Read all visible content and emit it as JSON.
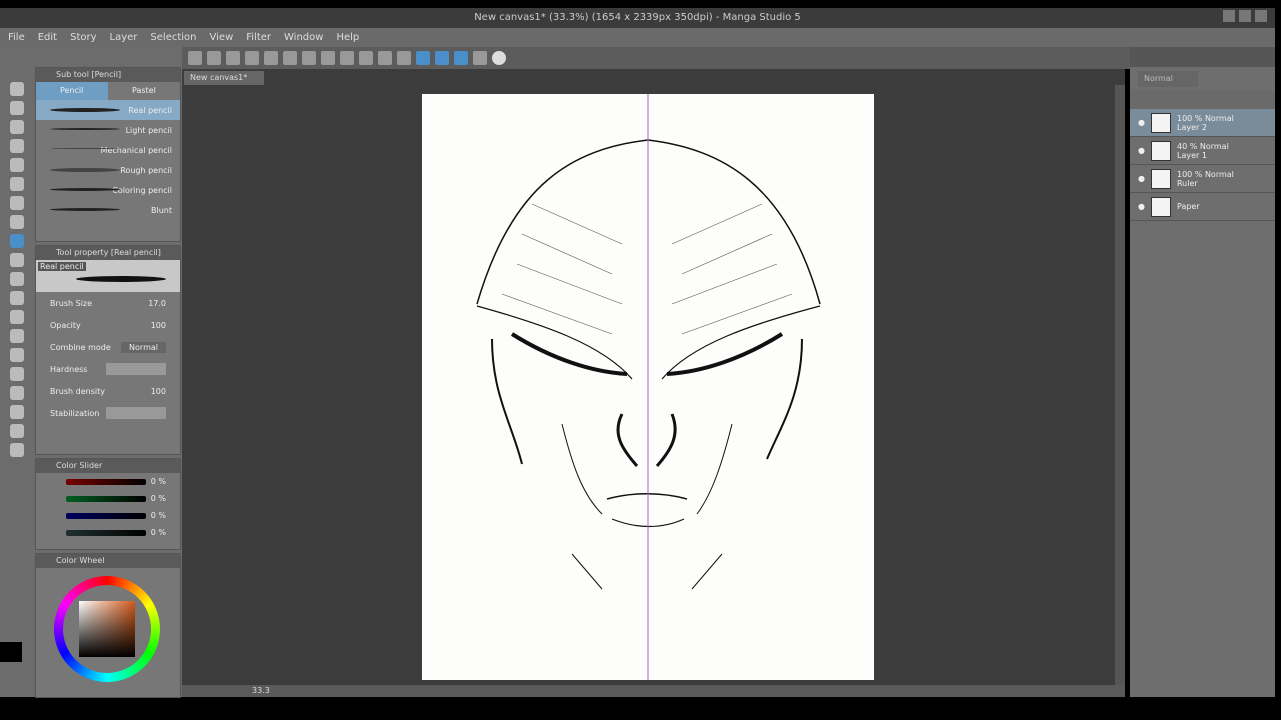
{
  "window": {
    "title": "New canvas1* (33.3%) (1654 x 2339px 350dpi) - Manga Studio 5"
  },
  "menu": [
    "File",
    "Edit",
    "Story",
    "Layer",
    "Selection",
    "View",
    "Filter",
    "Window",
    "Help"
  ],
  "document_tab": "New canvas1*",
  "subtool": {
    "header": "Sub tool [Pencil]",
    "tabs": [
      "Pencil",
      "Pastel"
    ],
    "brushes": [
      "Real pencil",
      "Light pencil",
      "Mechanical pencil",
      "Rough pencil",
      "Coloring pencil",
      "Blunt"
    ]
  },
  "tool_property": {
    "header": "Tool property [Real pencil]",
    "preview_label": "Real pencil",
    "brush_size_label": "Brush Size",
    "brush_size": "17.0",
    "opacity_label": "Opacity",
    "opacity": "100",
    "combine_label": "Combine mode",
    "combine_value": "Normal",
    "hardness_label": "Hardness",
    "density_label": "Brush density",
    "density": "100",
    "stabilization_label": "Stabilization"
  },
  "color_slider": {
    "header": "Color Slider",
    "values": [
      "0 %",
      "0 %",
      "0 %",
      "0 %"
    ],
    "colors": [
      "#7a0000",
      "#006020",
      "#000060",
      "#203030"
    ]
  },
  "color_wheel": {
    "header": "Color Wheel",
    "main_color": "#000000",
    "sub_color": "#ffffff"
  },
  "layers": {
    "blend": "Normal",
    "items": [
      {
        "opacity": "100 % Normal",
        "name": "Layer 2",
        "selected": true
      },
      {
        "opacity": "40 % Normal",
        "name": "Layer 1",
        "selected": false
      },
      {
        "opacity": "100 % Normal",
        "name": "Ruler",
        "selected": false
      },
      {
        "opacity": "",
        "name": "Paper",
        "selected": false
      }
    ]
  },
  "status": {
    "zoom": "33.3"
  },
  "colors": {
    "guide_line": "#9b6bc9",
    "accent": "#4a8fc9"
  }
}
